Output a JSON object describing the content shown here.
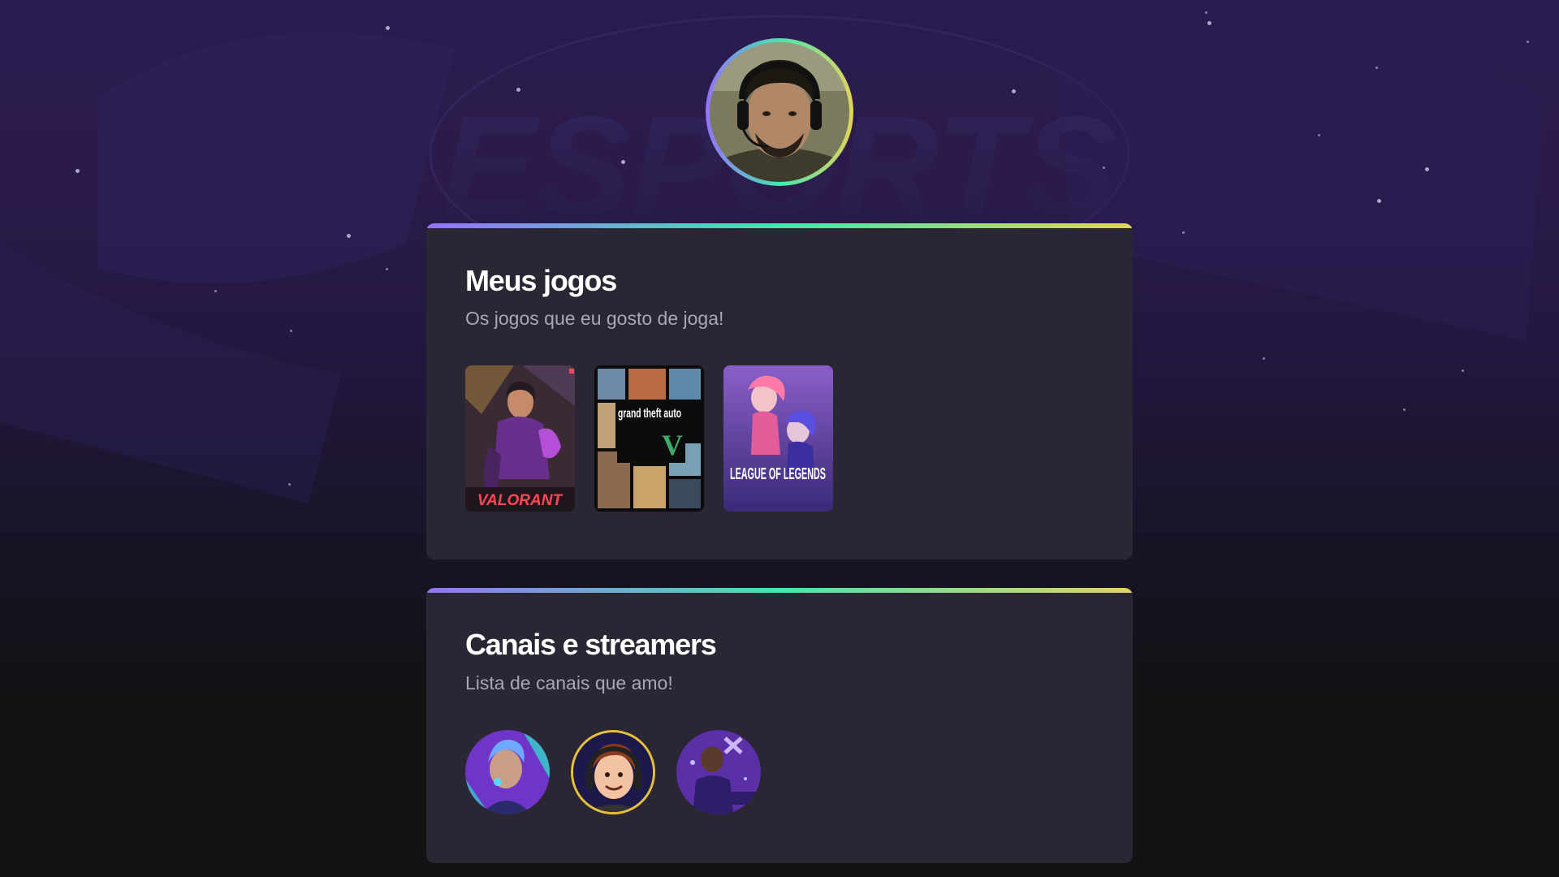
{
  "profile": {
    "avatar_icon": "profile-avatar-photo",
    "ring_colors": [
      "#9572fc",
      "#43e7ad",
      "#e2d45c"
    ]
  },
  "background": {
    "watermark_text": "ESPORTS",
    "colors": [
      "#2a1c4f",
      "#121214"
    ]
  },
  "games_section": {
    "title": "Meus jogos",
    "subtitle": "Os jogos que eu gosto de joga!",
    "games": [
      {
        "name": "VALORANT"
      },
      {
        "name": "grand theft auto"
      },
      {
        "name": "LEAGUE OF LEGENDS"
      }
    ]
  },
  "streamers_section": {
    "title": "Canais e streamers",
    "subtitle": "Lista de canais que amo!",
    "streamers": [
      {
        "icon": "streamer-avatar-1"
      },
      {
        "icon": "streamer-avatar-2"
      },
      {
        "icon": "streamer-avatar-3"
      }
    ]
  },
  "card": {
    "background": "#2a2634",
    "title_color": "#ffffff",
    "subtitle_color": "#a9a6b8"
  }
}
